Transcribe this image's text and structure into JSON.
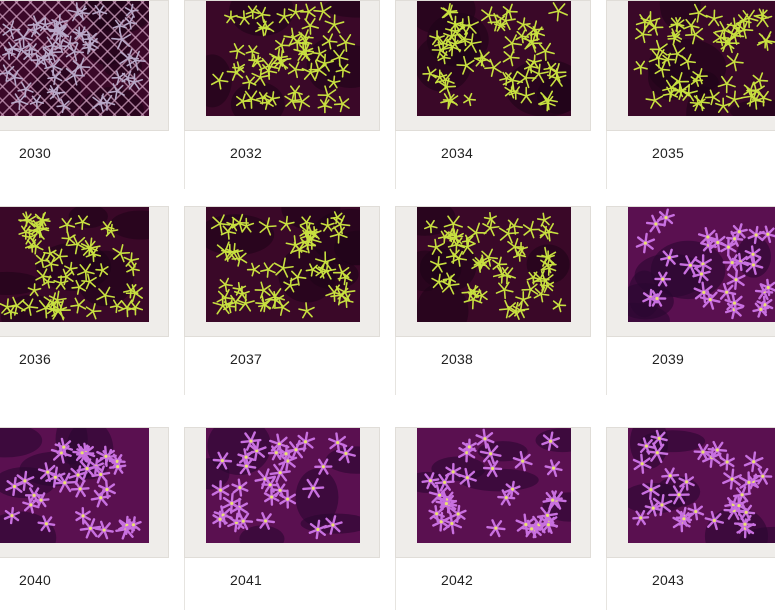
{
  "gallery": {
    "items": [
      {
        "label": "2030",
        "style": "gray"
      },
      {
        "label": "2032",
        "style": "green"
      },
      {
        "label": "2034",
        "style": "green"
      },
      {
        "label": "2035",
        "style": "green"
      },
      {
        "label": "2036",
        "style": "green"
      },
      {
        "label": "2037",
        "style": "green"
      },
      {
        "label": "2038",
        "style": "green"
      },
      {
        "label": "2039",
        "style": "purple"
      },
      {
        "label": "2040",
        "style": "purple"
      },
      {
        "label": "2041",
        "style": "purple"
      },
      {
        "label": "2042",
        "style": "purple"
      },
      {
        "label": "2043",
        "style": "purple"
      }
    ]
  },
  "colors": {
    "frame": "#efedea",
    "caption": "#222222",
    "bg_dark": "#3a0828",
    "bg_purple": "#5a1050",
    "polyp_green": "#c8e040",
    "polyp_purple": "#c870e0",
    "polyp_gray": "#b8a8c8"
  }
}
